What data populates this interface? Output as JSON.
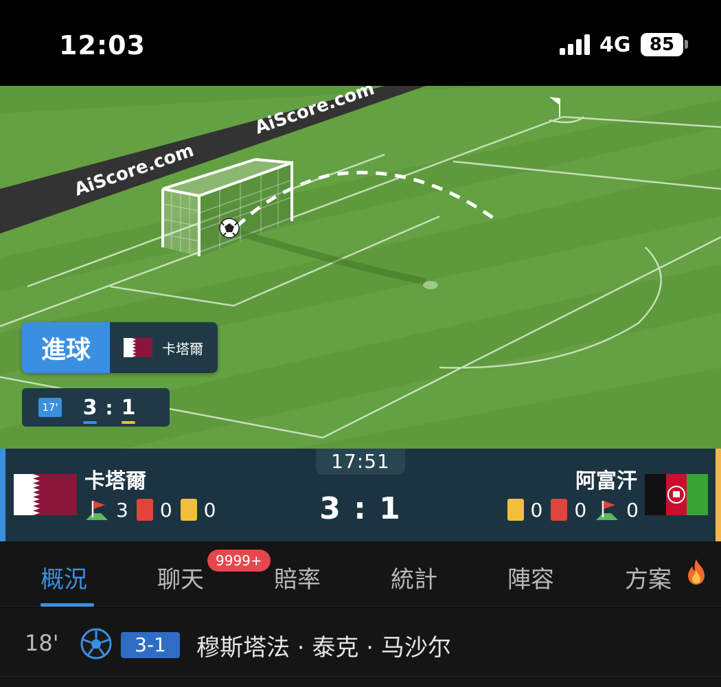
{
  "status_bar": {
    "time": "12:03",
    "network": "4G",
    "battery": "85"
  },
  "pitch": {
    "ad_text": "AiScore.com",
    "event_label": "進球",
    "event_team": "卡塔爾",
    "mini_minute": "17'",
    "mini_home": "3",
    "mini_colon": ":",
    "mini_away": "1"
  },
  "scoreboard": {
    "match_time": "17:51",
    "home": {
      "name": "卡塔爾",
      "corners": "3",
      "red_cards": "0",
      "yellow_cards": "0"
    },
    "away": {
      "name": "阿富汗",
      "yellow_cards": "0",
      "red_cards": "0",
      "corners": "0"
    },
    "score": "3 : 1"
  },
  "tabs": {
    "items": [
      {
        "label": "概況"
      },
      {
        "label": "聊天"
      },
      {
        "label": "賠率"
      },
      {
        "label": "統計"
      },
      {
        "label": "陣容"
      },
      {
        "label": "方案"
      }
    ],
    "chat_badge": "9999+"
  },
  "events": [
    {
      "minute": "18'",
      "score": "3-1",
      "player": "穆斯塔法 · 泰克 · 马沙尔"
    }
  ],
  "colors": {
    "accent": "#3b8fe0",
    "home_accent": "#3b8fe0",
    "away_accent": "#f2b84b",
    "badge_red": "#e5474c",
    "pitch_green": "#5e9a3c"
  }
}
